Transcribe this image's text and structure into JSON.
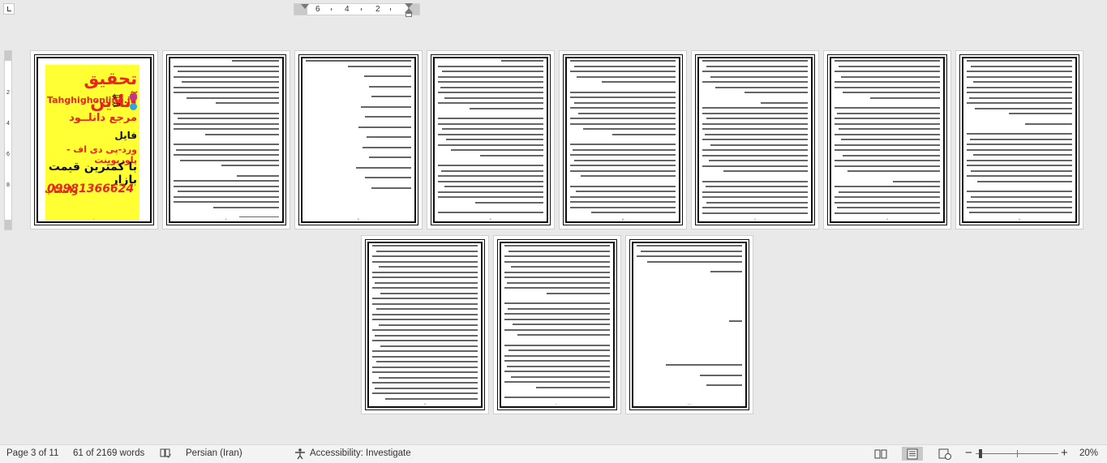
{
  "ruler": {
    "marks": [
      "6",
      "4",
      "2"
    ],
    "vertical_marks": [
      "2",
      "4",
      "6",
      "8"
    ]
  },
  "ad": {
    "title": "تحقیق آنلاین",
    "site": "Tahghighonline.ir",
    "line1": "مرجع دانلــود",
    "line2": "فایل",
    "line3": "ورد-پی دی اف - پاورپوینت",
    "line4": "با کمترین قیمت بازار",
    "phone": "09981366624",
    "whatsapp": "واتساپ"
  },
  "page_numbers": [
    "۱",
    "۲",
    "۳",
    "۴",
    "۵",
    "۶",
    "۷",
    "۸",
    "۹",
    "۱۰",
    "۱۱"
  ],
  "status": {
    "page": "Page 3 of 11",
    "words": "61 of 2169 words",
    "language": "Persian (Iran)",
    "accessibility": "Accessibility: Investigate",
    "zoom": "20%",
    "zoom_level": 0.2
  },
  "colors": {
    "ad_background": "#ffff33",
    "ad_red": "#e8261c",
    "ad_black": "#111111"
  }
}
